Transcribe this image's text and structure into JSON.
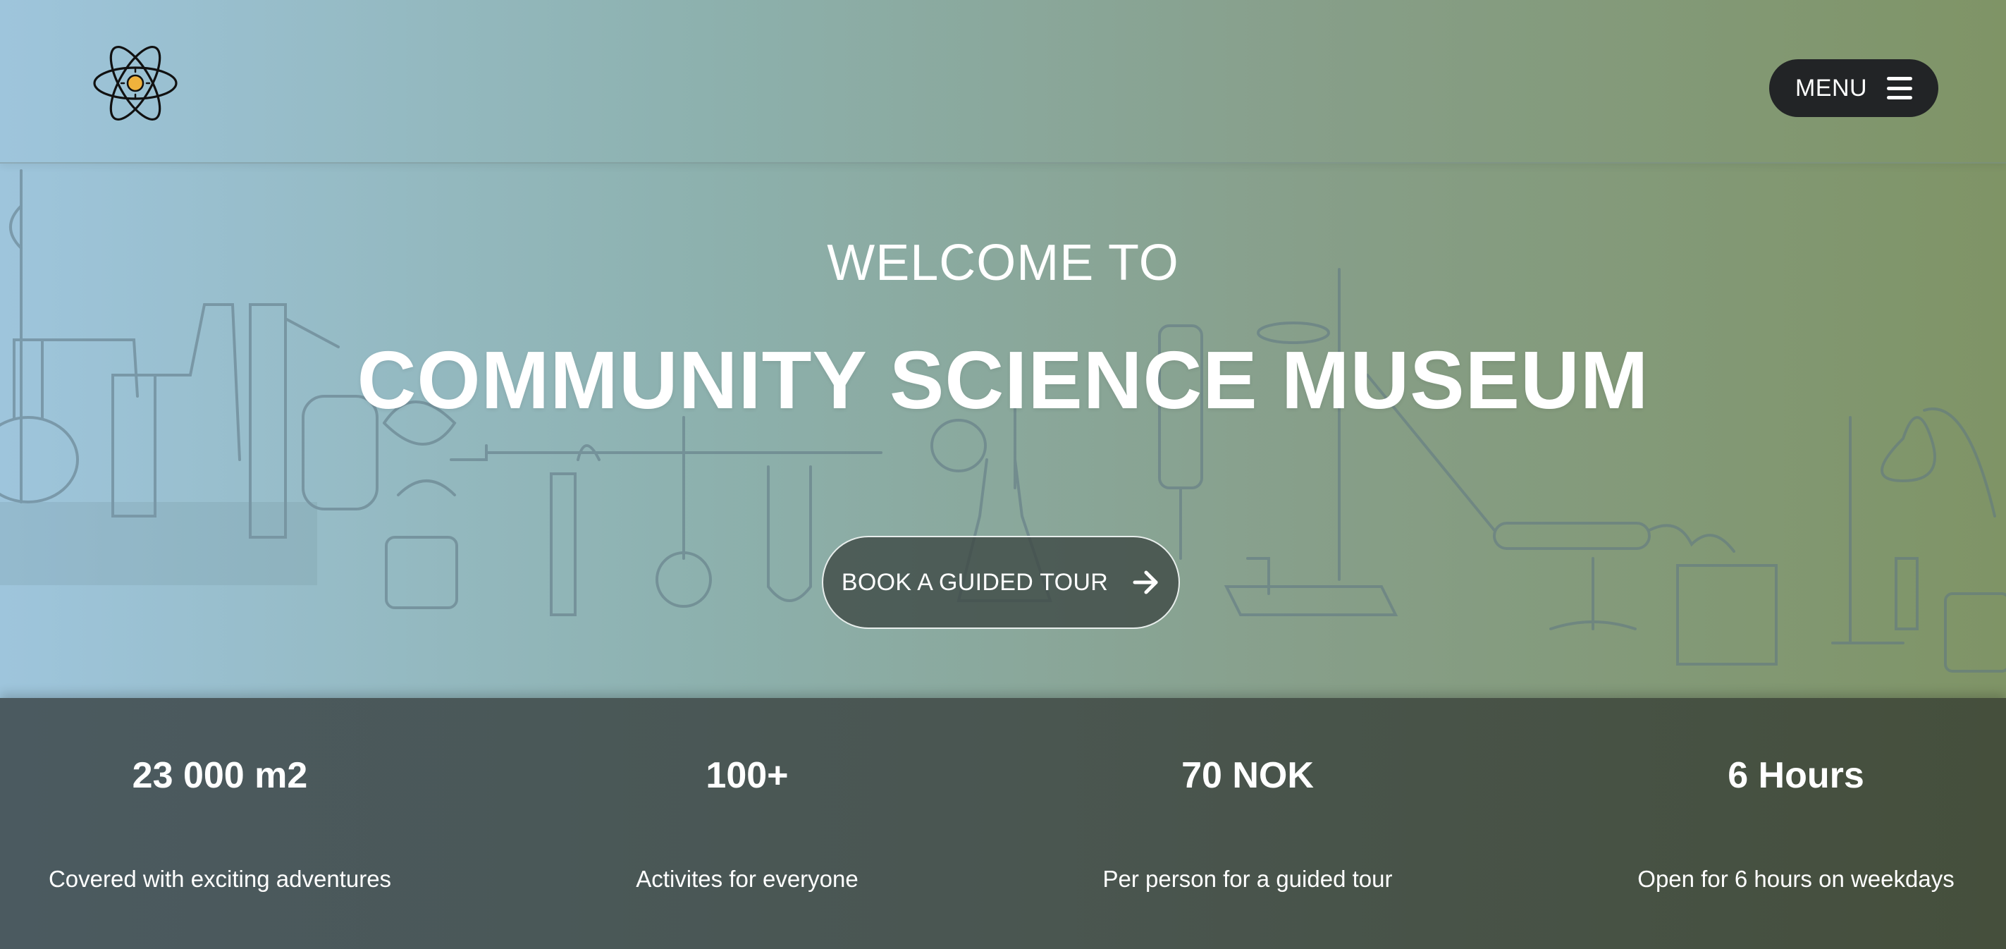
{
  "header": {
    "logo_icon": "atom-icon",
    "menu_label": "MENU",
    "menu_icon": "hamburger-icon"
  },
  "hero": {
    "background_icon": "laboratory-apparatus-illustration",
    "welcome": "WELCOME TO",
    "title": "COMMUNITY SCIENCE MUSEUM",
    "cta_label": "BOOK A GUIDED TOUR",
    "cta_icon": "arrow-right-icon"
  },
  "stats": [
    {
      "value": "23 000 m2",
      "caption": "Covered with exciting adventures"
    },
    {
      "value": "100+",
      "caption": "Activites for everyone"
    },
    {
      "value": "70 NOK",
      "caption": "Per person for a guided tour"
    },
    {
      "value": "6 Hours",
      "caption": "Open for 6 hours on weekdays"
    }
  ],
  "colors": {
    "menu_bg": "#222426",
    "logo_core": "#f0b23c",
    "gradient_left": "#9ec5dc",
    "gradient_right": "#7f9466",
    "stats_bg": "#4a5651"
  }
}
